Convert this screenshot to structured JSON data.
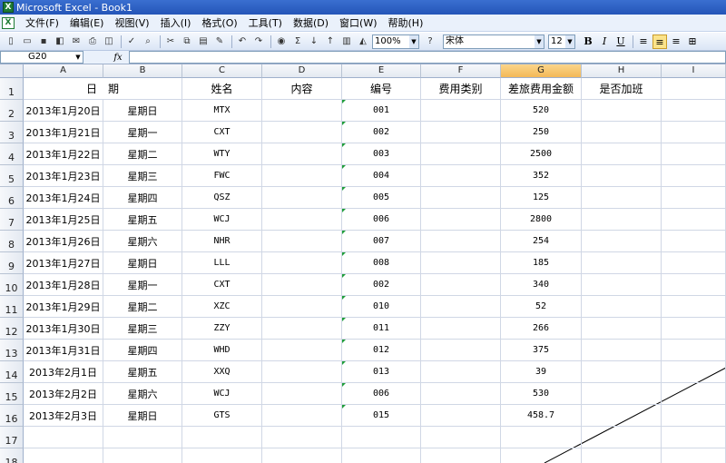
{
  "window": {
    "title": "Microsoft Excel - Book1"
  },
  "menu": [
    "文件(F)",
    "编辑(E)",
    "视图(V)",
    "插入(I)",
    "格式(O)",
    "工具(T)",
    "数据(D)",
    "窗口(W)",
    "帮助(H)"
  ],
  "toolbar": {
    "zoom": "100%",
    "font": "宋体",
    "font_size": "12"
  },
  "formula_bar": {
    "name_box": "G20",
    "fx": "fx"
  },
  "columns": [
    "A",
    "B",
    "C",
    "D",
    "E",
    "F",
    "G",
    "H",
    "I"
  ],
  "selected_column": "G",
  "header_row": [
    "日　期",
    "",
    "姓名",
    "内容",
    "编号",
    "费用类别",
    "差旅费用金额",
    "是否加班",
    ""
  ],
  "rows": [
    [
      "2013年1月20日",
      "星期日",
      "MTX",
      "",
      "001",
      "",
      "520"
    ],
    [
      "2013年1月21日",
      "星期一",
      "CXT",
      "",
      "002",
      "",
      "250"
    ],
    [
      "2013年1月22日",
      "星期二",
      "WTY",
      "",
      "003",
      "",
      "2500"
    ],
    [
      "2013年1月23日",
      "星期三",
      "FWC",
      "",
      "004",
      "",
      "352"
    ],
    [
      "2013年1月24日",
      "星期四",
      "QSZ",
      "",
      "005",
      "",
      "125"
    ],
    [
      "2013年1月25日",
      "星期五",
      "WCJ",
      "",
      "006",
      "",
      "2800"
    ],
    [
      "2013年1月26日",
      "星期六",
      "NHR",
      "",
      "007",
      "",
      "254"
    ],
    [
      "2013年1月27日",
      "星期日",
      "LLL",
      "",
      "008",
      "",
      "185"
    ],
    [
      "2013年1月28日",
      "星期一",
      "CXT",
      "",
      "002",
      "",
      "340"
    ],
    [
      "2013年1月29日",
      "星期二",
      "XZC",
      "",
      "010",
      "",
      "52"
    ],
    [
      "2013年1月30日",
      "星期三",
      "ZZY",
      "",
      "011",
      "",
      "266"
    ],
    [
      "2013年1月31日",
      "星期四",
      "WHD",
      "",
      "012",
      "",
      "375"
    ],
    [
      "2013年2月1日",
      "星期五",
      "XXQ",
      "",
      "013",
      "",
      "39"
    ],
    [
      "2013年2月2日",
      "星期六",
      "WCJ",
      "",
      "006",
      "",
      "530"
    ],
    [
      "2013年2月3日",
      "星期日",
      "GTS",
      "",
      "015",
      "",
      "458.7"
    ]
  ],
  "row_numbers": [
    "1",
    "2",
    "3",
    "4",
    "5",
    "6",
    "7",
    "8",
    "9",
    "10",
    "11",
    "12",
    "13",
    "14",
    "15",
    "16",
    "17",
    "18"
  ]
}
